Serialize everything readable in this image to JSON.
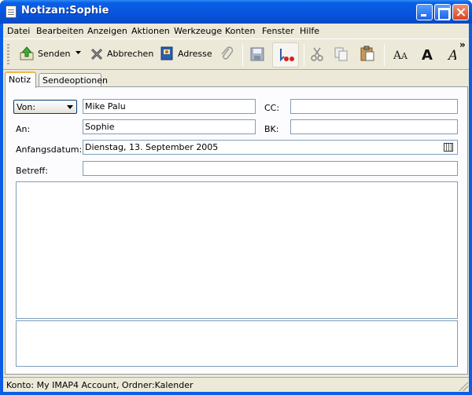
{
  "window": {
    "title": "Notizan:Sophie"
  },
  "menu": [
    "Datei",
    "Bearbeiten",
    "Anzeigen",
    "Aktionen",
    "Werkzeuge",
    "Konten",
    "Fenster",
    "Hilfe"
  ],
  "toolbar": {
    "send_label": "Senden",
    "cancel_label": "Abbrechen",
    "address_label": "Adresse",
    "overflow": "»"
  },
  "tabs": [
    "Notiz",
    "Sendeoptionen"
  ],
  "form": {
    "from_label": "Von:",
    "from_value": "Mike Palu",
    "to_label": "An:",
    "to_value": "Sophie",
    "cc_label": "CC:",
    "cc_value": "",
    "bcc_label": "BK:",
    "bcc_value": "",
    "start_label": "Anfangsdatum:",
    "start_value": "Dienstag, 13. September 2005",
    "subject_label": "Betreff:",
    "subject_value": ""
  },
  "status": {
    "text": "Konto: My IMAP4 Account,  Ordner:Kalender"
  },
  "colors": {
    "titlebar": "#0754dc",
    "face": "#ece9d8",
    "field_border": "#7f9db9",
    "active_tab": "#f1b64a"
  }
}
